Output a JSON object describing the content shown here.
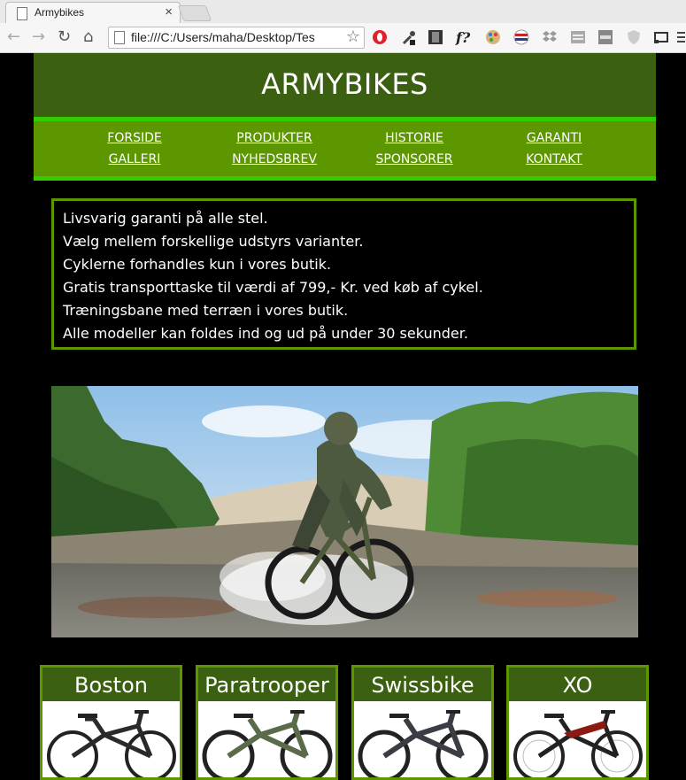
{
  "browser": {
    "tab_title": "Armybikes",
    "tab_close": "×",
    "url": "file:///C:/Users/maha/Desktop/Tes",
    "extension_icons": [
      "opera-icon",
      "eyedropper-icon",
      "film-icon",
      "font-f-icon",
      "paint-icon",
      "flag-icon",
      "dropbox-icon",
      "window-icon",
      "badge-icon",
      "shield-icon",
      "cast-icon",
      "menu-icon"
    ],
    "font_ext_label": "f?"
  },
  "site": {
    "title": "ARMYBIKES",
    "colors": {
      "header": "#3b6012",
      "nav": "#5c9700",
      "nav_border": "#33cc00",
      "background": "#000000"
    }
  },
  "nav": {
    "items": [
      {
        "label": "FORSIDE"
      },
      {
        "label": "PRODUKTER"
      },
      {
        "label": "HISTORIE"
      },
      {
        "label": "GARANTI"
      },
      {
        "label": "GALLERI"
      },
      {
        "label": "NYHEDSBREV"
      },
      {
        "label": "SPONSORER"
      },
      {
        "label": "KONTAKT"
      }
    ]
  },
  "info": {
    "lines": [
      "Livsvarig garanti på alle stel.",
      "Vælg mellem forskellige udstyrs varianter.",
      "Cyklerne forhandles kun i vores butik.",
      "Gratis transporttaske til værdi af 799,- Kr. ved køb af cykel.",
      "Træningsbane med terræn i vores butik.",
      "Alle modeller kan foldes ind og ud på under 30 sekunder."
    ]
  },
  "products": [
    {
      "name": "Boston",
      "frame_color": "#2a2a2a"
    },
    {
      "name": "Paratrooper",
      "frame_color": "#5a6b4a"
    },
    {
      "name": "Swissbike",
      "frame_color": "#3a3d44"
    },
    {
      "name": "XO",
      "frame_color": "#8a1a12"
    }
  ]
}
